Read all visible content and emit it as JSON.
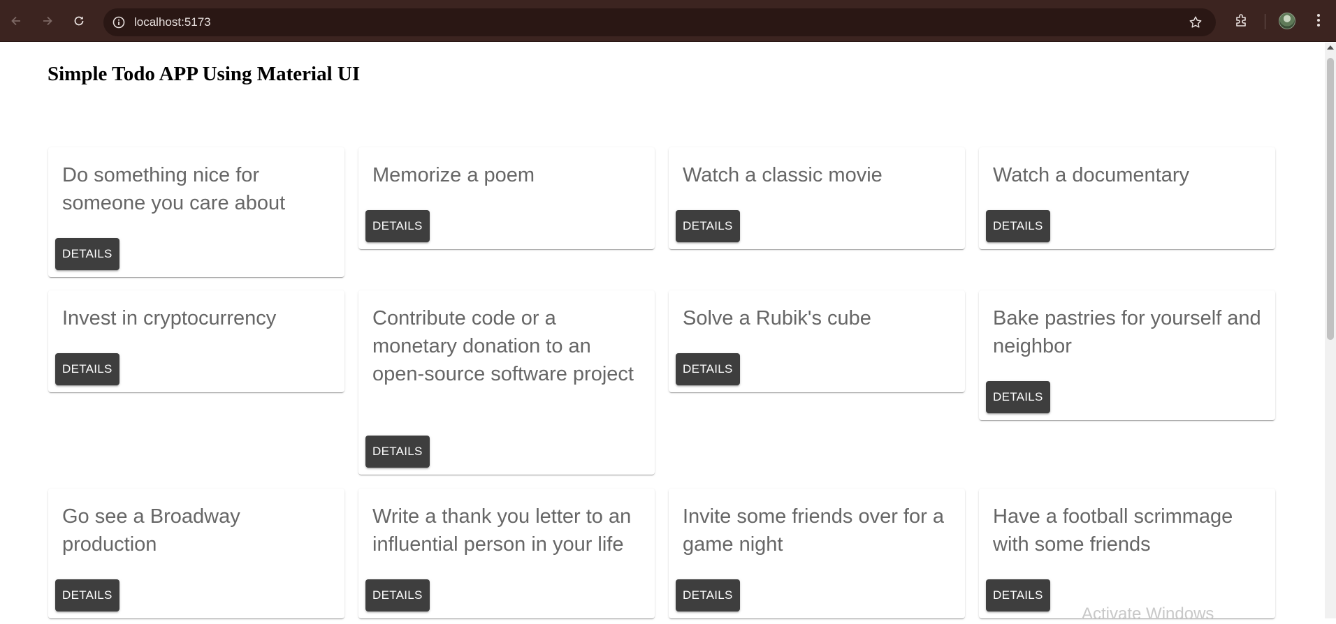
{
  "browser": {
    "url": "localhost:5173",
    "icons": {
      "back": "arrow-left-icon",
      "forward": "arrow-right-icon",
      "reload": "reload-icon",
      "site_info": "info-icon",
      "bookmark": "star-icon",
      "extensions": "puzzle-icon",
      "menu": "kebab-menu-icon"
    },
    "colors": {
      "chrome_bg": "#3c2420",
      "omnibox_bg": "#2a1714"
    }
  },
  "page": {
    "title": "Simple Todo APP Using Material UI",
    "button_label": "DETAILS",
    "colors": {
      "card_text": "#666666",
      "button_bg": "#3e3e3e"
    }
  },
  "todos": [
    {
      "title": "Do something nice for someone you care about"
    },
    {
      "title": "Memorize a poem"
    },
    {
      "title": "Watch a classic movie"
    },
    {
      "title": "Watch a documentary"
    },
    {
      "title": "Invest in cryptocurrency"
    },
    {
      "title": "Contribute code or a monetary donation to an open-source software project"
    },
    {
      "title": "Solve a Rubik's cube"
    },
    {
      "title": "Bake pastries for yourself and neighbor"
    },
    {
      "title": "Go see a Broadway production"
    },
    {
      "title": "Write a thank you letter to an influential person in your life"
    },
    {
      "title": "Invite some friends over for a game night"
    },
    {
      "title": "Have a football scrimmage with some friends"
    }
  ],
  "watermark": "Activate Windows"
}
